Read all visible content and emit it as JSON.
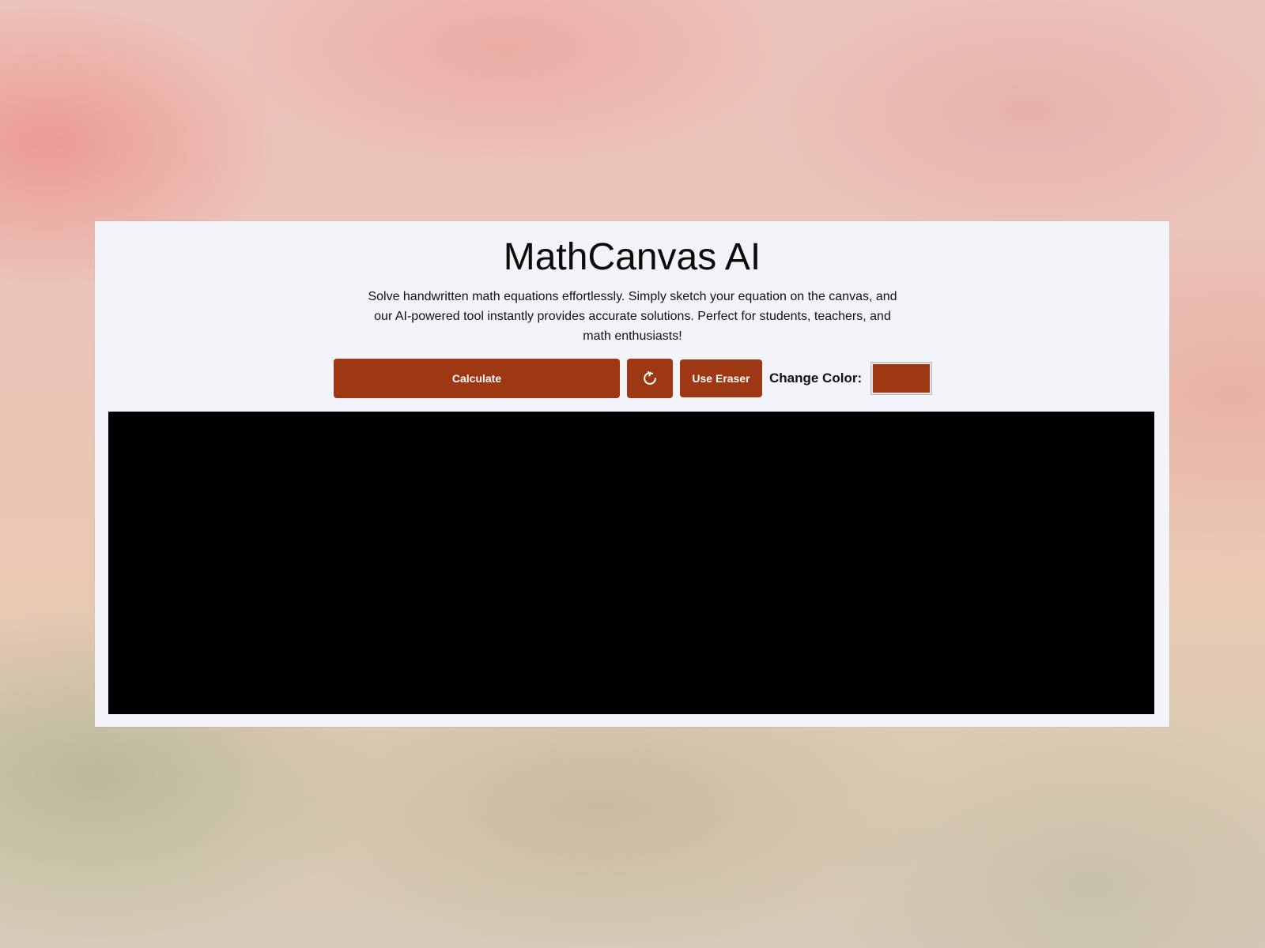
{
  "app": {
    "title": "MathCanvas AI",
    "description": "Solve handwritten math equations effortlessly. Simply sketch your equation on the canvas, and our AI-powered tool instantly provides accurate solutions. Perfect for students, teachers, and math enthusiasts!"
  },
  "toolbar": {
    "calculate_label": "Calculate",
    "reset_icon": "refresh-icon",
    "eraser_label": "Use Eraser",
    "change_color_label": "Change Color:",
    "selected_color": "#9d3714"
  },
  "theme": {
    "accent": "#9d3714",
    "canvas_bg": "#000000",
    "card_bg": "#f3f4f9"
  }
}
